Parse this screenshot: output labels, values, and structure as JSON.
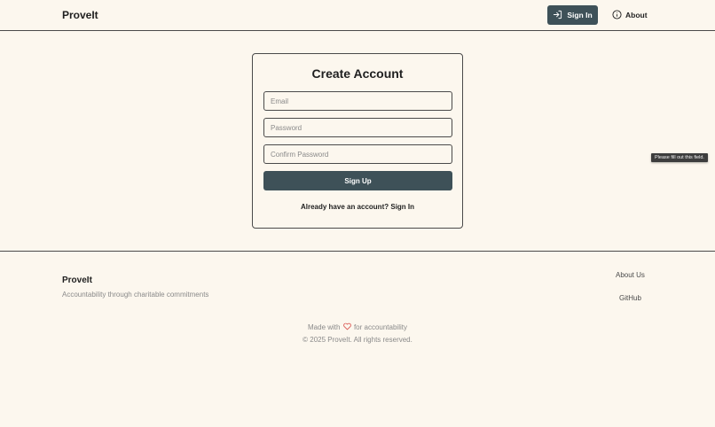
{
  "header": {
    "brand": "ProveIt",
    "signin_label": "Sign In",
    "about_label": "About"
  },
  "form": {
    "title": "Create Account",
    "email": {
      "value": "",
      "placeholder": "Email"
    },
    "password": {
      "value": "",
      "placeholder": "Password"
    },
    "confirm_password": {
      "value": "",
      "placeholder": "Confirm Password"
    },
    "signup_label": "Sign Up",
    "switch_prompt": "Already have an account?",
    "switch_link": "Sign In"
  },
  "tooltip": "Please fill out this field.",
  "footer": {
    "brand": "ProveIt",
    "tagline": "Accountability through charitable commitments",
    "links": [
      "About Us",
      "GitHub"
    ],
    "made_with_prefix": "Made with",
    "made_with_suffix": "for accountability",
    "copyright": "© 2025 ProveIt. All rights reserved."
  },
  "icons": {
    "signin": "sign-in-icon",
    "about": "info-icon",
    "heart": "heart-icon"
  },
  "colors": {
    "background": "#fcf7ee",
    "primary": "#3e5158",
    "heart": "#d9534f"
  }
}
